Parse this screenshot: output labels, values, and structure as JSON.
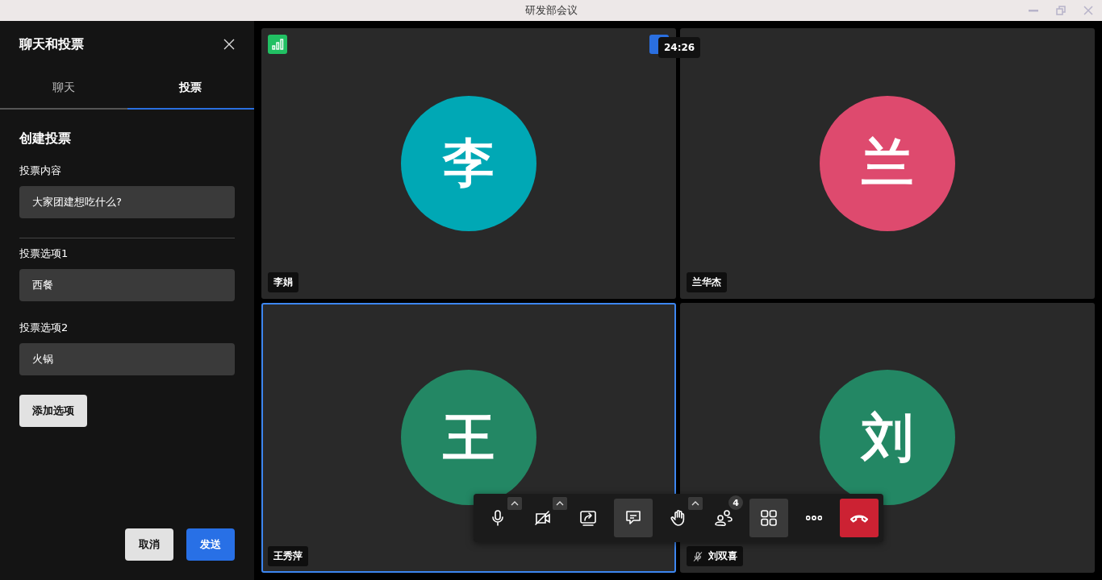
{
  "window": {
    "title": "研发部会议"
  },
  "panel": {
    "title": "聊天和投票",
    "tabs": [
      {
        "label": "聊天",
        "selected": false
      },
      {
        "label": "投票",
        "selected": true
      }
    ],
    "heading": "创建投票",
    "fields": [
      {
        "label": "投票内容",
        "value": "大家团建想吃什么?",
        "divider": true
      },
      {
        "label": "投票选项1",
        "value": "西餐",
        "divider": false
      },
      {
        "label": "投票选项2",
        "value": "火锅",
        "divider": false
      }
    ],
    "add_button": "添加选项",
    "buttons": [
      {
        "label": "取消",
        "kind": "secondary"
      },
      {
        "label": "发送",
        "kind": "primary"
      }
    ]
  },
  "timer": "24:26",
  "tiles": [
    {
      "initial": "李",
      "name": "李娟",
      "color": "#00a8b5",
      "selected": false,
      "muted": false,
      "signal": true,
      "menu": true
    },
    {
      "initial": "兰",
      "name": "兰华杰",
      "color": "#de4a6e",
      "selected": false,
      "muted": false,
      "signal": false,
      "menu": false
    },
    {
      "initial": "王",
      "name": "王秀萍",
      "color": "#238764",
      "selected": true,
      "muted": false,
      "signal": false,
      "menu": false
    },
    {
      "initial": "刘",
      "name": "刘双喜",
      "color": "#238764",
      "selected": false,
      "muted": true,
      "signal": false,
      "menu": false
    }
  ],
  "toolbar": {
    "items": [
      {
        "kind": "mic",
        "caret": true,
        "active": false
      },
      {
        "kind": "camera-off",
        "caret": true,
        "active": false
      },
      {
        "kind": "share",
        "caret": false,
        "active": false
      },
      {
        "kind": "chat",
        "caret": false,
        "active": true
      },
      {
        "kind": "hand",
        "caret": true,
        "active": false
      },
      {
        "kind": "participants",
        "caret": false,
        "active": false,
        "badge": "4"
      },
      {
        "kind": "grid",
        "caret": false,
        "active": true
      },
      {
        "kind": "more",
        "caret": false,
        "active": false
      },
      {
        "kind": "hangup",
        "caret": false,
        "active": false
      }
    ]
  }
}
